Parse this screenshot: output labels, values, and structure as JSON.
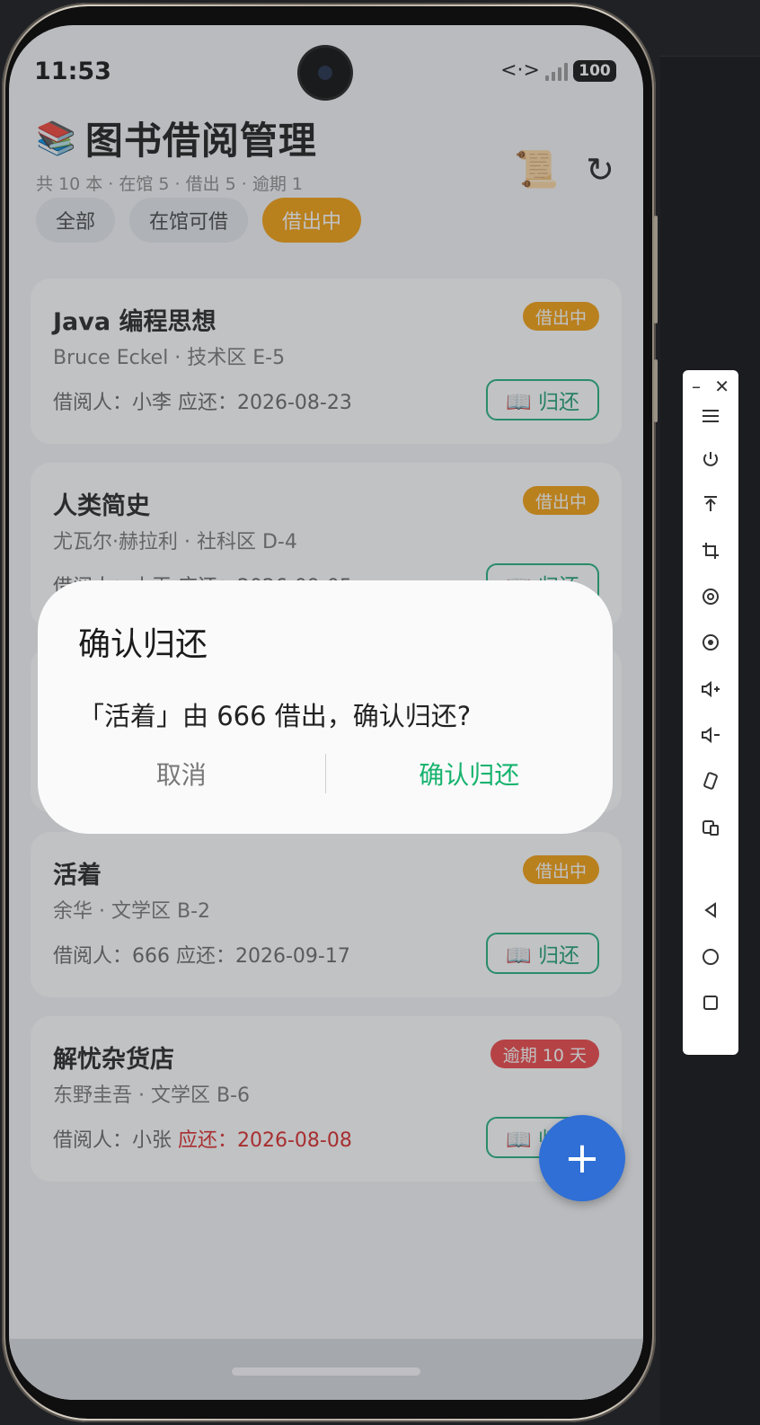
{
  "status_bar": {
    "time": "11:53",
    "net_icon": "<·>",
    "battery": "100"
  },
  "header": {
    "emoji": "📚",
    "title": "图书借阅管理",
    "stats": "共 10 本 · 在馆 5 · 借出 5 · 逾期 1",
    "scroll_icon": "📜",
    "refresh_icon": "↻"
  },
  "tabs": [
    {
      "label": "全部",
      "active": false
    },
    {
      "label": "在馆可借",
      "active": false
    },
    {
      "label": "借出中",
      "active": true
    }
  ],
  "books": [
    {
      "title": "Java 编程思想",
      "sub": "Bruce Eckel · 技术区 E-5",
      "borrower_line": "借阅人：小李  应还：2026-08-23",
      "badge": "借出中",
      "return_label": "📖 归还"
    },
    {
      "title": "人类简史",
      "sub": "尤瓦尔·赫拉利 · 社科区 D-4",
      "borrower_line": "借阅人：小王  应还：2026-09-05",
      "badge": "借出中",
      "return_label": "📖 归还"
    },
    {
      "title": "活着",
      "sub": "余华 · 文学区 B-2",
      "borrower_line": "借阅人：666  应还：2026-09-17",
      "badge": "借出中",
      "return_label": "📖 归还"
    },
    {
      "title": "解忧杂货店",
      "sub": "东野圭吾 · 文学区 B-6",
      "borrower_prefix": "借阅人：小张  ",
      "due_overdue": "应还：2026-08-08",
      "badge": "逾期 10 天",
      "return_label": "📖 归还"
    }
  ],
  "dialog": {
    "title": "确认归还",
    "message": "「活着」由 666 借出，确认归还?",
    "cancel": "取消",
    "confirm": "确认归还"
  },
  "fab": {
    "label": "+"
  },
  "emulator_toolbar": {
    "minimize": "–",
    "close": "✕"
  },
  "colors": {
    "accent_orange": "#f59e0b",
    "overdue_red": "#ef4444",
    "confirm_green": "#16b36e",
    "fab_blue": "#2f6fd6"
  }
}
